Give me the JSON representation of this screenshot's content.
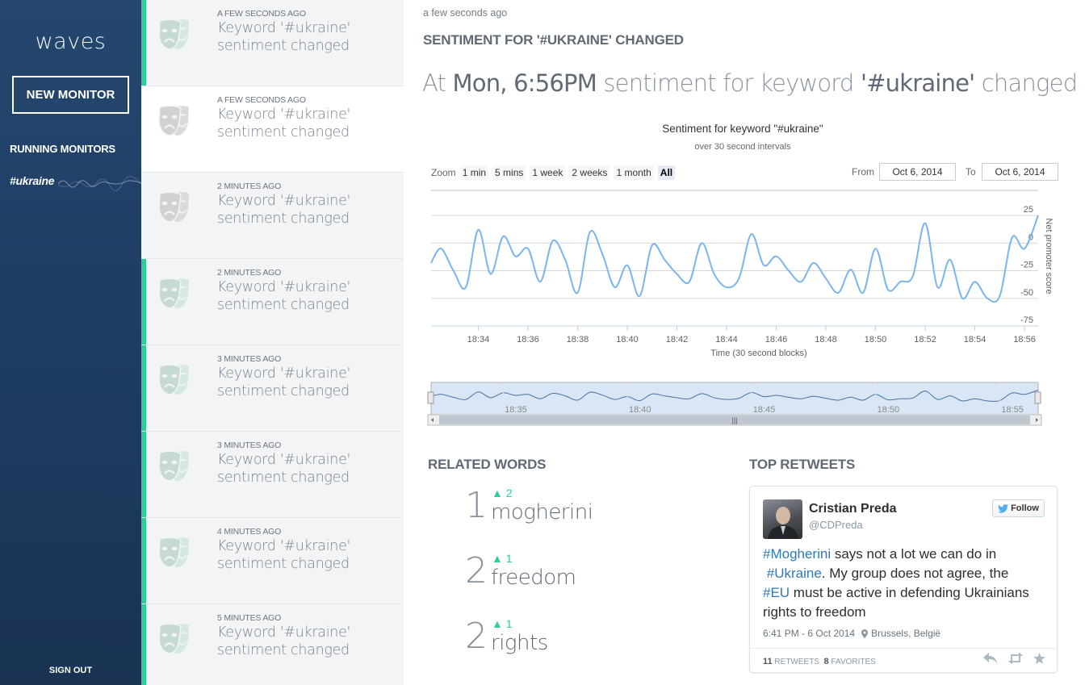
{
  "sidebar": {
    "logo": "waves",
    "new_monitor": "NEW MONITOR",
    "running_label": "RUNNING MONITORS",
    "monitor": "#ukraine",
    "sign_out": "SIGN OUT"
  },
  "notifications": [
    {
      "time": "A FEW SECONDS AGO",
      "line1": "Keyword '#ukraine'",
      "line2": "sentiment changed",
      "highlighted": true
    },
    {
      "time": "A FEW SECONDS AGO",
      "line1": "Keyword '#ukraine'",
      "line2": "sentiment changed",
      "highlighted": false
    },
    {
      "time": "2 MINUTES AGO",
      "line1": "Keyword '#ukraine'",
      "line2": "sentiment changed",
      "highlighted": false
    },
    {
      "time": "2 MINUTES AGO",
      "line1": "Keyword '#ukraine'",
      "line2": "sentiment changed",
      "highlighted": true
    },
    {
      "time": "3 MINUTES AGO",
      "line1": "Keyword '#ukraine'",
      "line2": "sentiment changed",
      "highlighted": true
    },
    {
      "time": "3 MINUTES AGO",
      "line1": "Keyword '#ukraine'",
      "line2": "sentiment changed",
      "highlighted": true
    },
    {
      "time": "4 MINUTES AGO",
      "line1": "Keyword '#ukraine'",
      "line2": "sentiment changed",
      "highlighted": true
    },
    {
      "time": "5 MINUTES AGO",
      "line1": "Keyword '#ukraine'",
      "line2": "sentiment changed",
      "highlighted": true
    }
  ],
  "main": {
    "relative_time": "a few seconds ago",
    "headline": "SENTIMENT FOR '#UKRAINE' CHANGED",
    "title_at": "At",
    "title_when": "Mon, 6:56PM",
    "title_mid": "sentiment for keyword",
    "title_keyword": "'#ukraine'",
    "title_end": "changed"
  },
  "chart_controls": {
    "zoom_label": "Zoom",
    "zoom_options": [
      "1 min",
      "5 mins",
      "1 week",
      "2 weeks",
      "1 month",
      "All"
    ],
    "zoom_selected": "All",
    "from_label": "From",
    "from_value": "Oct 6, 2014",
    "to_label": "To",
    "to_value": "Oct 6, 2014"
  },
  "chart_data": {
    "type": "line",
    "title": "Sentiment for keyword \"#ukraine\"",
    "subtitle": "over 30 second intervals",
    "xlabel": "Time (30 second blocks)",
    "ylabel": "Net promoter score",
    "x_ticks": [
      "18:34",
      "18:36",
      "18:38",
      "18:40",
      "18:42",
      "18:44",
      "18:46",
      "18:48",
      "18:50",
      "18:52",
      "18:54",
      "18:56"
    ],
    "y_ticks": [
      25,
      0,
      -25,
      -50,
      -75
    ],
    "ylim": [
      -75,
      25
    ],
    "xlim_minutes": [
      32.1,
      56.55
    ],
    "grid": true,
    "color": "#7cb5ec",
    "series": [
      {
        "x_minutes": [
          32.1,
          32.5,
          33.0,
          33.5,
          34.0,
          34.5,
          35.0,
          35.5,
          36.0,
          36.5,
          37.0,
          37.5,
          38.0,
          38.5,
          39.0,
          39.5,
          40.0,
          40.5,
          41.0,
          41.5,
          42.0,
          42.5,
          43.0,
          43.5,
          44.0,
          44.5,
          45.0,
          45.5,
          46.0,
          46.5,
          47.0,
          47.5,
          48.0,
          48.5,
          49.0,
          49.5,
          50.0,
          50.5,
          51.0,
          51.5,
          52.0,
          52.5,
          53.0,
          53.5,
          54.0,
          54.5,
          55.0,
          55.5,
          56.0,
          56.55
        ],
        "values": [
          -18,
          -5,
          -25,
          -40,
          12,
          -28,
          6,
          -12,
          -5,
          -35,
          2,
          -15,
          -45,
          10,
          -10,
          -40,
          -20,
          -48,
          -2,
          -15,
          -28,
          -35,
          0,
          -28,
          -40,
          -32,
          8,
          -20,
          -12,
          -25,
          -35,
          -18,
          -32,
          -45,
          -24,
          -45,
          -5,
          -42,
          -35,
          -30,
          18,
          -40,
          -15,
          -50,
          -35,
          -50,
          -48,
          5,
          -5,
          25
        ]
      }
    ],
    "navigator_ticks": [
      "18:35",
      "18:40",
      "18:45",
      "18:50",
      "18:55"
    ]
  },
  "related": {
    "heading": "RELATED WORDS",
    "words": [
      {
        "rank": "1",
        "delta": "▲ 2",
        "word": "mogherini"
      },
      {
        "rank": "2",
        "delta": "▲ 1",
        "word": "freedom"
      },
      {
        "rank": "2",
        "delta": "▲ 1",
        "word": "rights"
      }
    ]
  },
  "retweets": {
    "heading": "TOP RETWEETS",
    "tweet": {
      "name": "Cristian Preda",
      "handle": "@CDPreda",
      "follow": "Follow",
      "tag1": "#Mogherini",
      "text1": " says not a lot we can do in",
      "tag2": "#Ukraine",
      "text2": ". My group does not agree, the",
      "tag3": "#EU",
      "text3": " must be active in defending Ukrainians rights to freedom",
      "timestamp": "6:41 PM - 6 Oct 2014",
      "location": "Brussels, België",
      "retweets_count": "11",
      "retweets_label": "RETWEETS",
      "favorites_count": "8",
      "favorites_label": "FAVORITES"
    }
  },
  "colors": {
    "sidebar": "#1e3a5f",
    "accent": "#2ecb9b",
    "line": "#7cb5ec",
    "link": "#2b7bb9"
  }
}
